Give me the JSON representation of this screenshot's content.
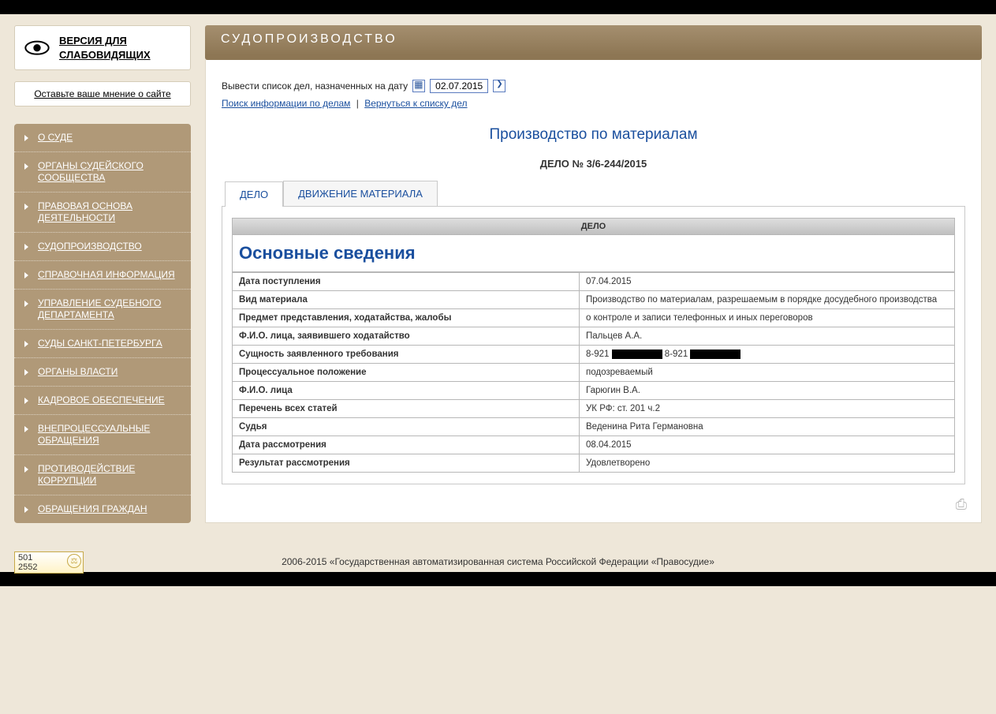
{
  "accessibility_link": "ВЕРСИЯ ДЛЯ СЛАБОВИДЯЩИХ",
  "feedback_link": "Оставьте ваше мнение о сайте",
  "sidebar": {
    "items": [
      "О СУДЕ",
      "ОРГАНЫ СУДЕЙСКОГО СООБЩЕСТВА",
      "ПРАВОВАЯ ОСНОВА ДЕЯТЕЛЬНОСТИ",
      "СУДОПРОИЗВОДСТВО",
      "СПРАВОЧНАЯ ИНФОРМАЦИЯ",
      "УПРАВЛЕНИЕ СУДЕБНОГО ДЕПАРТАМЕНТА",
      "СУДЫ САНКТ-ПЕТЕРБУРГА",
      "ОРГАНЫ ВЛАСТИ",
      "КАДРОВОЕ ОБЕСПЕЧЕНИЕ",
      "ВНЕПРОЦЕССУАЛЬНЫЕ ОБРАЩЕНИЯ",
      "ПРОТИВОДЕЙСТВИЕ КОРРУПЦИИ",
      "ОБРАЩЕНИЯ ГРАЖДАН"
    ]
  },
  "banner_title": "СУДОПРОИЗВОДСТВО",
  "filter_label": "Вывести список дел, назначенных на дату",
  "filter_date": "02.07.2015",
  "link_search": "Поиск информации по делам",
  "link_back": "Вернуться к списку дел",
  "prod_title": "Производство по материалам",
  "case_number": "ДЕЛО № 3/6-244/2015",
  "tabs": {
    "case": "ДЕЛО",
    "movement": "ДВИЖЕНИЕ МАТЕРИАЛА"
  },
  "table_header": "ДЕЛО",
  "section_title": "Основные сведения",
  "rows": [
    {
      "k": "Дата поступления",
      "v": "07.04.2015"
    },
    {
      "k": "Вид материала",
      "v": "Производство по материалам, разрешаемым в порядке досудебного производства"
    },
    {
      "k": "Предмет представления, ходатайства, жалобы",
      "v": "о контроле и записи телефонных и иных переговоров"
    },
    {
      "k": "Ф.И.О. лица, заявившего ходатайство",
      "v": "Пальцев А.А."
    },
    {
      "k": "Сущность заявленного требования",
      "v": "8-921 ███ 8-921 ███",
      "redacted": true,
      "p1": "8-921",
      "p2": "8-921"
    },
    {
      "k": "Процессуальное положение",
      "v": "подозреваемый"
    },
    {
      "k": "Ф.И.О. лица",
      "v": "Гарюгин В.А."
    },
    {
      "k": "Перечень всех статей",
      "v": "УК РФ: ст. 201 ч.2"
    },
    {
      "k": "Судья",
      "v": "Веденина Рита Германовна"
    },
    {
      "k": "Дата рассмотрения",
      "v": "08.04.2015"
    },
    {
      "k": "Результат рассмотрения",
      "v": "Удовлетворено"
    }
  ],
  "footer_text": "2006-2015 «Государственная автоматизированная система Российской Федерации «Правосудие»",
  "counter": {
    "line1": "501",
    "line2": "2552"
  }
}
